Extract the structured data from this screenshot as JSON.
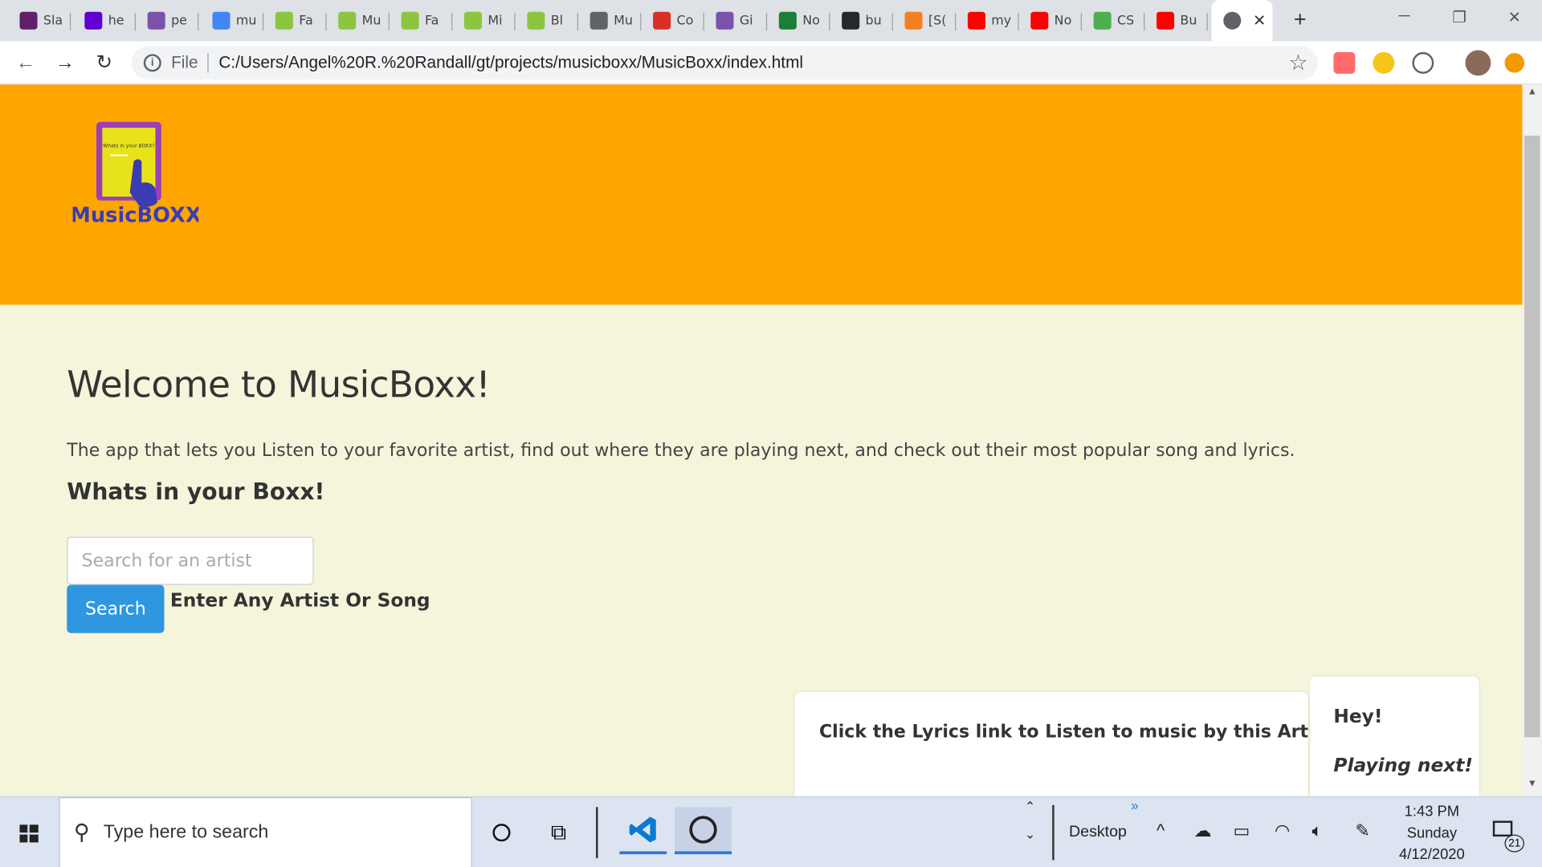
{
  "browser": {
    "tabs": [
      {
        "label": "Sla",
        "icon": "slack-icon",
        "color": "#611f69"
      },
      {
        "label": "he",
        "icon": "yahoo-icon",
        "color": "#6001d2"
      },
      {
        "label": "pe",
        "icon": "hackerrank-icon",
        "color": "#7b52ab"
      },
      {
        "label": "mu",
        "icon": "google-icon",
        "color": "#4285f4"
      },
      {
        "label": "Fa",
        "icon": "page-icon",
        "color": "#8cc63f"
      },
      {
        "label": "Mu",
        "icon": "page-icon",
        "color": "#8cc63f"
      },
      {
        "label": "Fa",
        "icon": "page-icon",
        "color": "#8cc63f"
      },
      {
        "label": "Mi",
        "icon": "page-icon",
        "color": "#8cc63f"
      },
      {
        "label": "Bl",
        "icon": "page-icon",
        "color": "#8cc63f"
      },
      {
        "label": "Mu",
        "icon": "globe-icon",
        "color": "#5f6368"
      },
      {
        "label": "Co",
        "icon": "gmail-icon",
        "color": "#d93025"
      },
      {
        "label": "Gi",
        "icon": "hackerrank-icon",
        "color": "#7b52ab"
      },
      {
        "label": "No",
        "icon": "gdrive-icon",
        "color": "#1a7f37"
      },
      {
        "label": "bu",
        "icon": "github-icon",
        "color": "#24292e"
      },
      {
        "label": "[S(",
        "icon": "stackoverflow-icon",
        "color": "#f48024"
      },
      {
        "label": "my",
        "icon": "youtube-icon",
        "color": "#ff0000"
      },
      {
        "label": "No",
        "icon": "youtube-icon",
        "color": "#ff0000"
      },
      {
        "label": "CS",
        "icon": "w3-icon",
        "color": "#4caf50"
      },
      {
        "label": "Bu",
        "icon": "youtube-icon",
        "color": "#ff0000"
      }
    ],
    "active_tab_icon": "globe-icon",
    "file_label": "File",
    "url": "C:/Users/Angel%20R.%20Randall/gt/projects/musicboxx/MusicBoxx/index.html"
  },
  "page": {
    "logo_text": "MusicBOXX",
    "logo_screen_text": "Whats in your BOXX?",
    "title": "Welcome to MusicBoxx!",
    "lead": "The app that lets you Listen to your favorite artist, find out where they are playing next, and check out their most popular song and lyrics.",
    "subtitle": "Whats in your Boxx!",
    "search_placeholder": "Search for an artist",
    "search_button": "Search",
    "search_hint": "Enter Any Artist Or Song",
    "lyrics_card_text": "Click the Lyrics link to Listen to music by this Artist!",
    "event_card_hey": "Hey!",
    "event_card_next": "Playing next!",
    "colors": {
      "header": "#ffa500",
      "background": "#f5f5dc",
      "button": "#2e97e0"
    }
  },
  "taskbar": {
    "search_placeholder": "Type here to search",
    "desktop_label": "Desktop",
    "time": "1:43 PM",
    "day": "Sunday",
    "date": "4/12/2020",
    "notification_count": "21"
  }
}
